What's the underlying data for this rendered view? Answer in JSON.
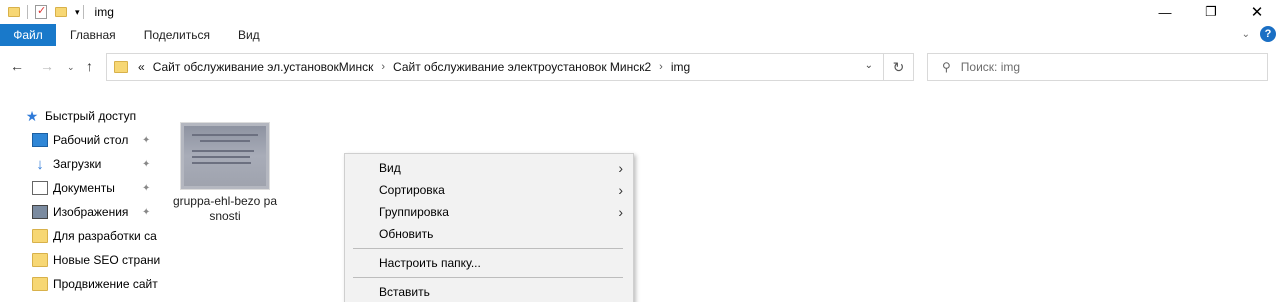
{
  "title_bar": {
    "title": "img",
    "minimize_glyph": "—",
    "maximize_glyph": "❐",
    "close_glyph": "✕"
  },
  "ribbon": {
    "file_tab": "Файл",
    "tabs": [
      "Главная",
      "Поделиться",
      "Вид"
    ]
  },
  "address_bar": {
    "overflow": "«",
    "crumbs": [
      "Сайт обслуживание эл.установокМинск",
      "Сайт обслуживание электроустановок Минск2",
      "img"
    ],
    "separator": "›"
  },
  "search": {
    "placeholder": "Поиск: img"
  },
  "sidebar": {
    "items": [
      {
        "label": "Быстрый доступ",
        "icon": "star-icon",
        "pinned": false
      },
      {
        "label": "Рабочий стол",
        "icon": "desktop-icon",
        "pinned": true
      },
      {
        "label": "Загрузки",
        "icon": "download-icon",
        "pinned": true
      },
      {
        "label": "Документы",
        "icon": "document-icon",
        "pinned": true
      },
      {
        "label": "Изображения",
        "icon": "pictures-icon",
        "pinned": true
      },
      {
        "label": "Для разработки са",
        "icon": "folder-icon",
        "pinned": false
      },
      {
        "label": "Новые SEO страни",
        "icon": "folder-icon",
        "pinned": false
      },
      {
        "label": "Продвижение сайт",
        "icon": "folder-icon",
        "pinned": false
      }
    ]
  },
  "files": [
    {
      "name": "gruppa-ehl-bezo pasnosti",
      "type": "image"
    }
  ],
  "context_menu": {
    "items": [
      {
        "label": "Вид",
        "submenu": true
      },
      {
        "label": "Сортировка",
        "submenu": true
      },
      {
        "label": "Группировка",
        "submenu": true
      },
      {
        "label": "Обновить",
        "submenu": false
      },
      {
        "label": "Настроить папку...",
        "submenu": false
      },
      {
        "label": "Вставить",
        "submenu": false
      }
    ]
  },
  "colors": {
    "file_tab": "#1979ca",
    "accent": "#1a6fc4",
    "folder": "#f7d774"
  }
}
